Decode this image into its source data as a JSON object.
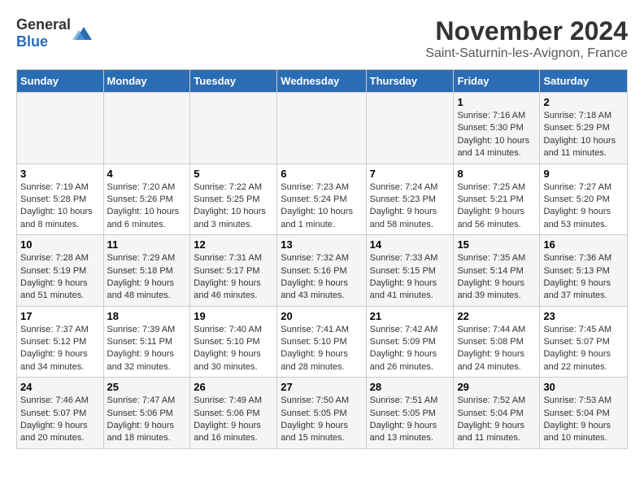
{
  "header": {
    "logo_general": "General",
    "logo_blue": "Blue",
    "month_title": "November 2024",
    "location": "Saint-Saturnin-les-Avignon, France"
  },
  "weekdays": [
    "Sunday",
    "Monday",
    "Tuesday",
    "Wednesday",
    "Thursday",
    "Friday",
    "Saturday"
  ],
  "weeks": [
    {
      "days": [
        {
          "num": "",
          "info": ""
        },
        {
          "num": "",
          "info": ""
        },
        {
          "num": "",
          "info": ""
        },
        {
          "num": "",
          "info": ""
        },
        {
          "num": "",
          "info": ""
        },
        {
          "num": "1",
          "info": "Sunrise: 7:16 AM\nSunset: 5:30 PM\nDaylight: 10 hours and 14 minutes."
        },
        {
          "num": "2",
          "info": "Sunrise: 7:18 AM\nSunset: 5:29 PM\nDaylight: 10 hours and 11 minutes."
        }
      ]
    },
    {
      "days": [
        {
          "num": "3",
          "info": "Sunrise: 7:19 AM\nSunset: 5:28 PM\nDaylight: 10 hours and 8 minutes."
        },
        {
          "num": "4",
          "info": "Sunrise: 7:20 AM\nSunset: 5:26 PM\nDaylight: 10 hours and 6 minutes."
        },
        {
          "num": "5",
          "info": "Sunrise: 7:22 AM\nSunset: 5:25 PM\nDaylight: 10 hours and 3 minutes."
        },
        {
          "num": "6",
          "info": "Sunrise: 7:23 AM\nSunset: 5:24 PM\nDaylight: 10 hours and 1 minute."
        },
        {
          "num": "7",
          "info": "Sunrise: 7:24 AM\nSunset: 5:23 PM\nDaylight: 9 hours and 58 minutes."
        },
        {
          "num": "8",
          "info": "Sunrise: 7:25 AM\nSunset: 5:21 PM\nDaylight: 9 hours and 56 minutes."
        },
        {
          "num": "9",
          "info": "Sunrise: 7:27 AM\nSunset: 5:20 PM\nDaylight: 9 hours and 53 minutes."
        }
      ]
    },
    {
      "days": [
        {
          "num": "10",
          "info": "Sunrise: 7:28 AM\nSunset: 5:19 PM\nDaylight: 9 hours and 51 minutes."
        },
        {
          "num": "11",
          "info": "Sunrise: 7:29 AM\nSunset: 5:18 PM\nDaylight: 9 hours and 48 minutes."
        },
        {
          "num": "12",
          "info": "Sunrise: 7:31 AM\nSunset: 5:17 PM\nDaylight: 9 hours and 46 minutes."
        },
        {
          "num": "13",
          "info": "Sunrise: 7:32 AM\nSunset: 5:16 PM\nDaylight: 9 hours and 43 minutes."
        },
        {
          "num": "14",
          "info": "Sunrise: 7:33 AM\nSunset: 5:15 PM\nDaylight: 9 hours and 41 minutes."
        },
        {
          "num": "15",
          "info": "Sunrise: 7:35 AM\nSunset: 5:14 PM\nDaylight: 9 hours and 39 minutes."
        },
        {
          "num": "16",
          "info": "Sunrise: 7:36 AM\nSunset: 5:13 PM\nDaylight: 9 hours and 37 minutes."
        }
      ]
    },
    {
      "days": [
        {
          "num": "17",
          "info": "Sunrise: 7:37 AM\nSunset: 5:12 PM\nDaylight: 9 hours and 34 minutes."
        },
        {
          "num": "18",
          "info": "Sunrise: 7:39 AM\nSunset: 5:11 PM\nDaylight: 9 hours and 32 minutes."
        },
        {
          "num": "19",
          "info": "Sunrise: 7:40 AM\nSunset: 5:10 PM\nDaylight: 9 hours and 30 minutes."
        },
        {
          "num": "20",
          "info": "Sunrise: 7:41 AM\nSunset: 5:10 PM\nDaylight: 9 hours and 28 minutes."
        },
        {
          "num": "21",
          "info": "Sunrise: 7:42 AM\nSunset: 5:09 PM\nDaylight: 9 hours and 26 minutes."
        },
        {
          "num": "22",
          "info": "Sunrise: 7:44 AM\nSunset: 5:08 PM\nDaylight: 9 hours and 24 minutes."
        },
        {
          "num": "23",
          "info": "Sunrise: 7:45 AM\nSunset: 5:07 PM\nDaylight: 9 hours and 22 minutes."
        }
      ]
    },
    {
      "days": [
        {
          "num": "24",
          "info": "Sunrise: 7:46 AM\nSunset: 5:07 PM\nDaylight: 9 hours and 20 minutes."
        },
        {
          "num": "25",
          "info": "Sunrise: 7:47 AM\nSunset: 5:06 PM\nDaylight: 9 hours and 18 minutes."
        },
        {
          "num": "26",
          "info": "Sunrise: 7:49 AM\nSunset: 5:06 PM\nDaylight: 9 hours and 16 minutes."
        },
        {
          "num": "27",
          "info": "Sunrise: 7:50 AM\nSunset: 5:05 PM\nDaylight: 9 hours and 15 minutes."
        },
        {
          "num": "28",
          "info": "Sunrise: 7:51 AM\nSunset: 5:05 PM\nDaylight: 9 hours and 13 minutes."
        },
        {
          "num": "29",
          "info": "Sunrise: 7:52 AM\nSunset: 5:04 PM\nDaylight: 9 hours and 11 minutes."
        },
        {
          "num": "30",
          "info": "Sunrise: 7:53 AM\nSunset: 5:04 PM\nDaylight: 9 hours and 10 minutes."
        }
      ]
    }
  ]
}
